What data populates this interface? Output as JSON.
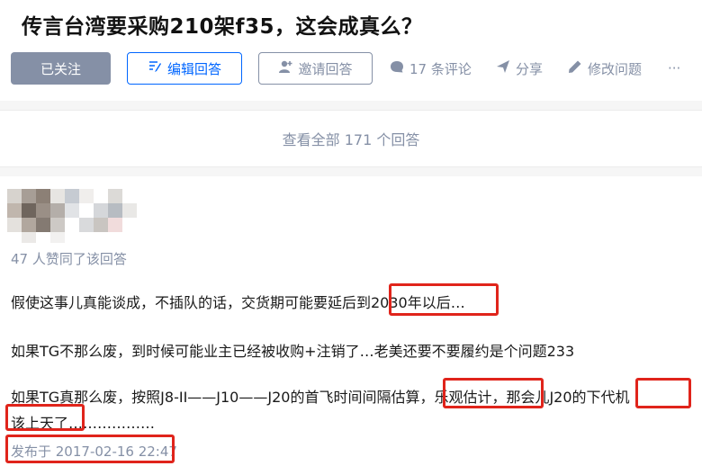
{
  "question": {
    "title": "传言台湾要采购210架f35，这会成真么？"
  },
  "actions": {
    "follow_label": "已关注",
    "edit_label": "编辑回答",
    "invite_label": "邀请回答",
    "comments_label": "17 条评论",
    "share_label": "分享",
    "modify_label": "修改问题",
    "more_label": "···"
  },
  "answers": {
    "view_all_label": "查看全部 171 个回答"
  },
  "answer": {
    "votes_text": "47 人赞同了该回答",
    "p1": "假使这事儿真能谈成，不插队的话，交货期可能要延后到2030年以后…",
    "p2": "如果TG不那么废，到时候可能业主已经被收购+注销了…老美还要不要履约是个问题233",
    "p3_line1": "如果TG真那么废，按照J8-II——J10——J20的首飞时间间隔估算，乐观估计，那会儿J20的下代机",
    "p3_line2": "该上天了………………",
    "date_text": "发布于 2017-02-16 22:47"
  },
  "colors": {
    "accent": "#0066ff",
    "muted": "#8590a6",
    "highlight": "#e0241b"
  },
  "icons": {
    "edit": "edit-icon",
    "invite": "add-user-icon",
    "comment": "comment-icon",
    "share": "share-icon",
    "modify": "pencil-icon",
    "more": "more-icon"
  }
}
